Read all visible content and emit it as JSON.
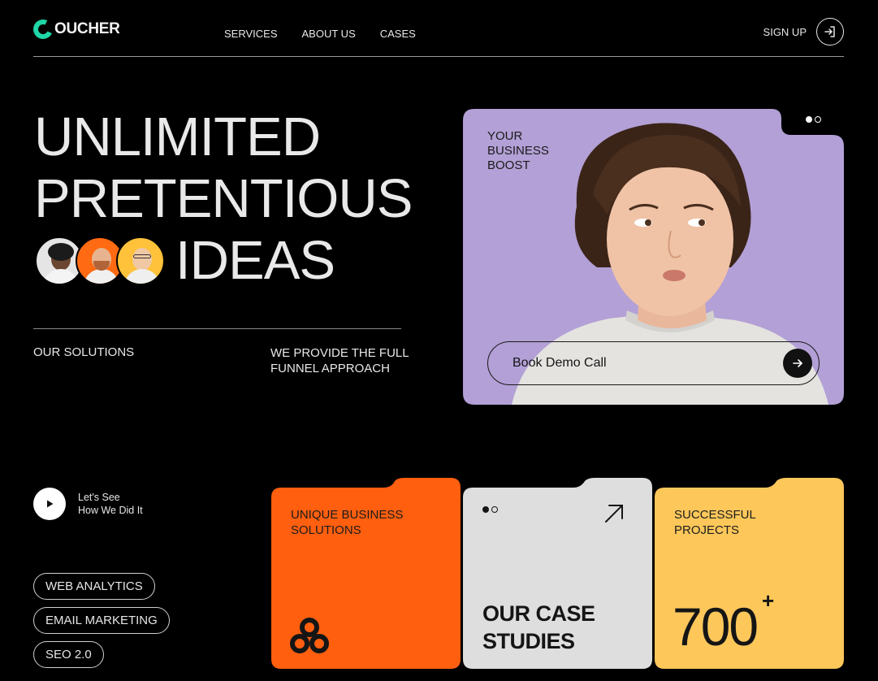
{
  "header": {
    "logo_text": "OUCHER",
    "nav": [
      "SERVICES",
      "ABOUT US",
      "CASES"
    ],
    "signup_label": "SIGN UP"
  },
  "hero": {
    "line1": "UNLIMITED",
    "line2": "PRETENTIOUS",
    "line3": "IDEAS",
    "solutions_label": "OUR SOLUTIONS",
    "funnel_text": "WE PROVIDE THE FULL FUNNEL APPROACH"
  },
  "promo_card": {
    "tag": "YOUR BUSINESS BOOST",
    "cta_label": "Book Demo Call",
    "color": "#b3a0d6"
  },
  "video": {
    "label_line1": "Let's See",
    "label_line2": "How We Did It"
  },
  "tags": [
    "WEB ANALYTICS",
    "EMAIL MARKETING",
    "SEO 2.0"
  ],
  "cards": {
    "unique": {
      "title": "UNIQUE BUSINESS SOLUTIONS",
      "color": "#ff5f0f"
    },
    "case": {
      "title_line1": "OUR CASE",
      "title_line2": "STUDIES",
      "color": "#dedede"
    },
    "projects": {
      "title": "SUCCESSFUL PROJECTS",
      "count": "700",
      "suffix": "+",
      "color": "#fdc75a"
    }
  },
  "colors": {
    "accent": "#1fd6a6",
    "background": "#000000"
  }
}
